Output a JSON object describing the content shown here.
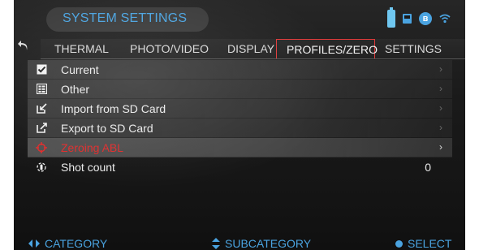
{
  "header": {
    "title": "SYSTEM SETTINGS",
    "icons": [
      "battery-icon",
      "sd-card-icon",
      "bluetooth-icon",
      "wifi-icon"
    ],
    "bt_glyph": "ʙ"
  },
  "tabs": [
    {
      "label": "THERMAL",
      "active": false
    },
    {
      "label": "PHOTO/VIDEO",
      "active": false
    },
    {
      "label": "DISPLAY",
      "active": false
    },
    {
      "label": "PROFILES/ZERO",
      "active": true
    },
    {
      "label": "SETTINGS",
      "active": false
    }
  ],
  "menu": {
    "items": [
      {
        "label": "Current",
        "icon": "checkbox-icon",
        "chevron": "›"
      },
      {
        "label": "Other",
        "icon": "list-icon",
        "chevron": "›"
      },
      {
        "label": "Import from SD Card",
        "icon": "import-icon",
        "chevron": "›"
      },
      {
        "label": "Export to SD Card",
        "icon": "export-icon",
        "chevron": "›"
      },
      {
        "label": "Zeroing ABL",
        "icon": "zeroing-icon",
        "chevron": "›",
        "selected": true
      },
      {
        "label": "Shot count",
        "icon": "shot-count-icon",
        "value": "0"
      }
    ]
  },
  "footer": {
    "category": "CATEGORY",
    "subcategory": "SUBCATEGORY",
    "select": "SELECT"
  },
  "colors": {
    "accent": "#4aa3e0",
    "active_tab_border": "#e03a3a",
    "selected_text": "#e02b2b"
  }
}
